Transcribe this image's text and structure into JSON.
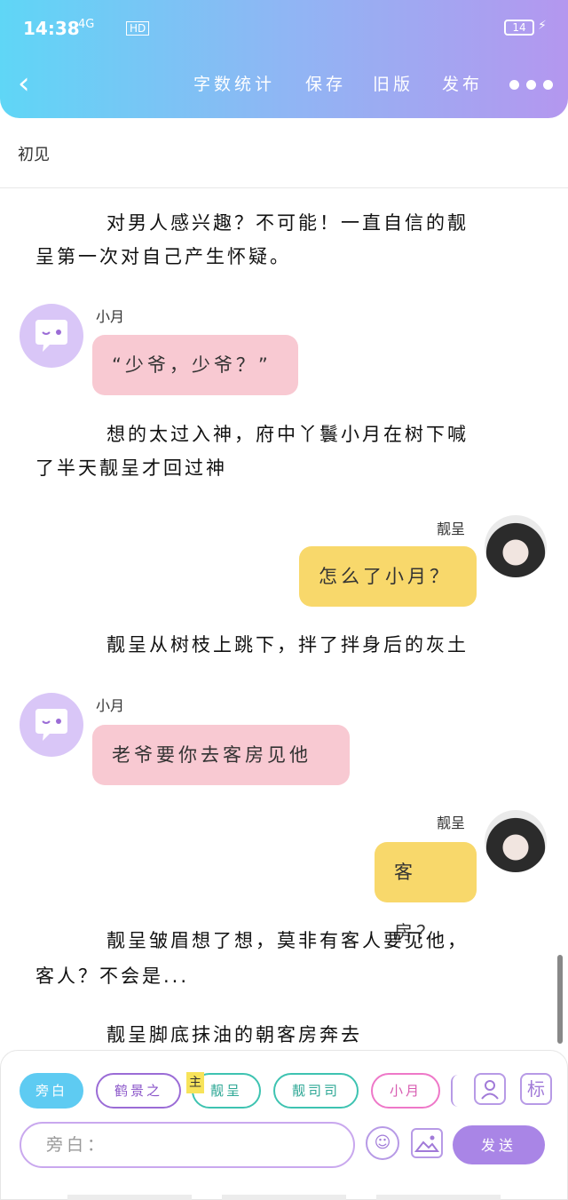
{
  "status_bar": {
    "time": "14:38",
    "network": "4G",
    "hd": "HD",
    "battery": "14"
  },
  "header": {
    "nav": {
      "word_count": "字数统计",
      "save": "保存",
      "old_version": "旧版",
      "publish": "发布"
    }
  },
  "chapter": {
    "title": "初见"
  },
  "story": {
    "para1_line1": "对男人感兴趣？不可能！一直自信的靓",
    "para1_line2": "呈第一次对自己产生怀疑。",
    "msg1_speaker": "小月",
    "msg1_text": "“少爷，少爷？”",
    "para2_line1": "想的太过入神，府中丫鬟小月在树下喊",
    "para2_line2": "了半天靓呈才回过神",
    "msg2_speaker": "靓呈",
    "msg2_text": "怎么了小月？",
    "para3": "靓呈从树枝上跳下，拌了拌身后的灰土",
    "msg3_speaker": "小月",
    "msg3_text": "老爷要你去客房见他",
    "msg4_speaker": "靓呈",
    "msg4_text": "客房？",
    "para4_line1": "靓呈皱眉想了想，莫非有客人要见他，",
    "para4_line2": "客人？不会是...",
    "para5": "靓呈脚底抹油的朝客房奔去"
  },
  "composer": {
    "roles": [
      {
        "label": "旁白"
      },
      {
        "label": "鹤景之"
      },
      {
        "label": "靓呈",
        "tag": "主"
      },
      {
        "label": "靓司司"
      },
      {
        "label": "小月"
      }
    ],
    "tool_label": "标",
    "input_placeholder": "旁白：",
    "send_label": "发送"
  },
  "colors": {
    "header_gradient_start": "#5fd6f6",
    "header_gradient_end": "#b497ef",
    "pink_bubble": "#f8c9d2",
    "yellow_bubble": "#f8d86b",
    "send_button": "#a985e6"
  }
}
